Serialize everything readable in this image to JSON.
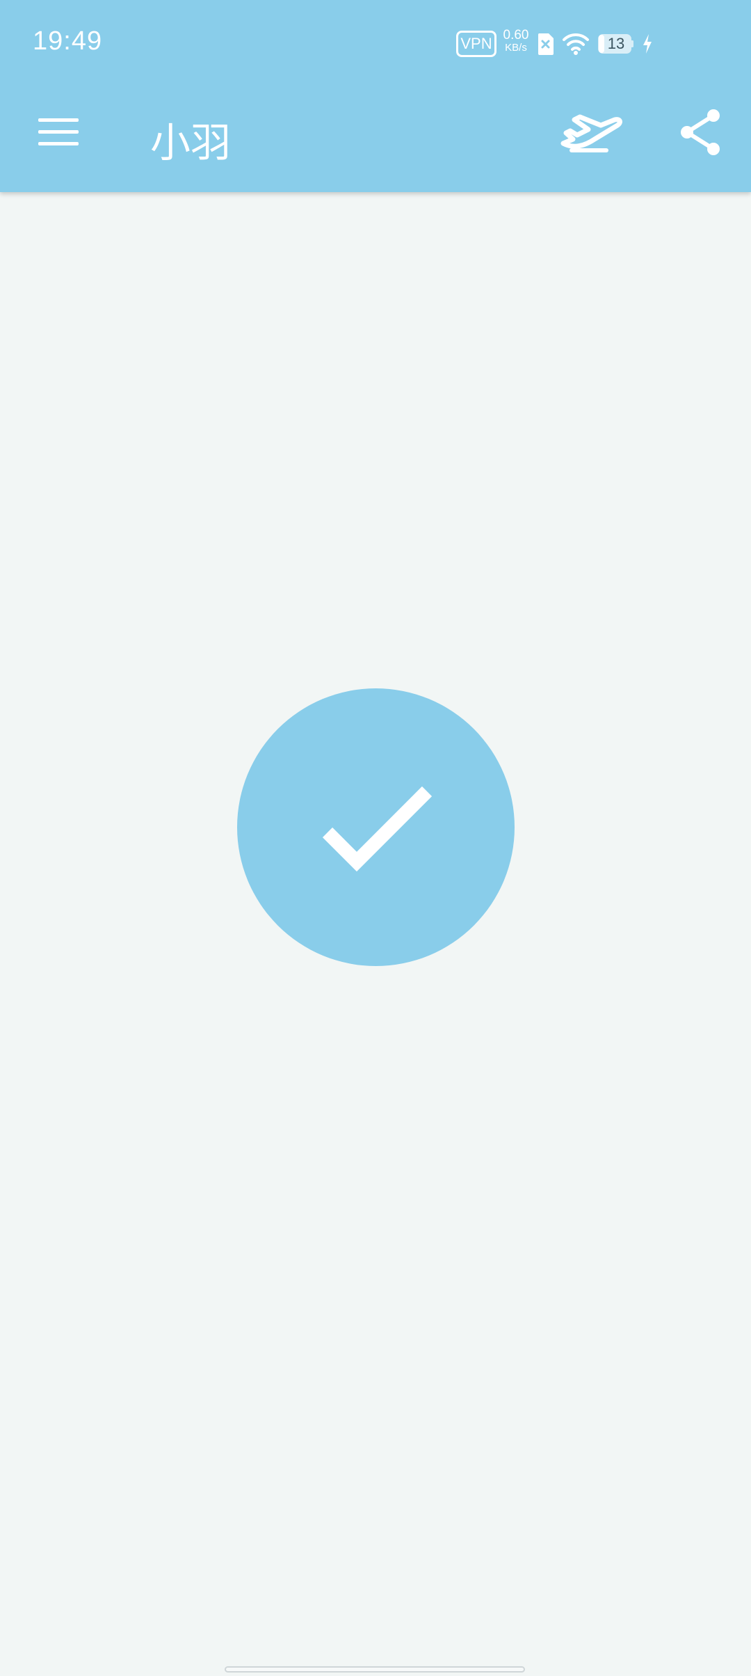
{
  "status_bar": {
    "time": "19:49",
    "vpn_label": "VPN",
    "net_speed_value": "0.60",
    "net_speed_unit": "KB/s",
    "battery_level": "13"
  },
  "app_bar": {
    "title": "小羽",
    "icons": [
      "menu-icon",
      "plane-icon",
      "share-icon"
    ]
  },
  "main": {
    "status_icon": "check-icon"
  },
  "colors": {
    "primary": "#89cdea",
    "background": "#f2f6f5",
    "on_primary": "#ffffff"
  }
}
